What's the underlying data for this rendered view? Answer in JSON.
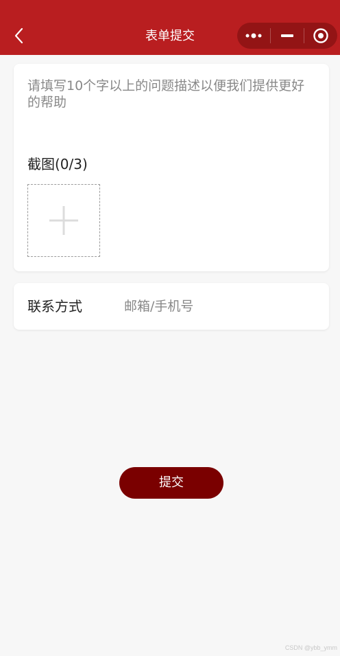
{
  "navbar": {
    "title": "表单提交",
    "background": "#b91e20",
    "back_icon": "chevron-left-icon",
    "capsule": {
      "more_icon": "more-dots-icon",
      "minimize_icon": "minimize-icon",
      "close_icon": "target-circle-icon"
    }
  },
  "description": {
    "placeholder": "请填写10个字以上的问题描述以便我们提供更好的帮助",
    "value": ""
  },
  "screenshots": {
    "label": "截图(0/3)",
    "add_icon": "plus-icon"
  },
  "contact": {
    "label": "联系方式",
    "placeholder": "邮箱/手机号",
    "value": ""
  },
  "submit": {
    "label": "提交",
    "color": "#7a0000"
  },
  "watermark": "CSDN @ybb_ymm"
}
